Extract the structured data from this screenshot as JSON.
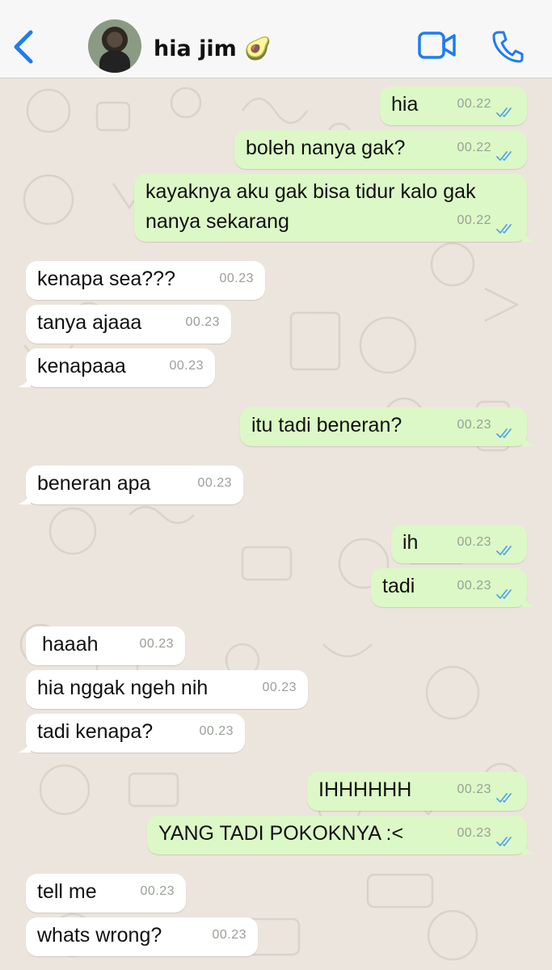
{
  "header": {
    "contact_name": "hia jim 🥑",
    "icons": [
      "chevron-left-icon",
      "video-camera-icon",
      "phone-icon"
    ],
    "accent_color": "#1f7cf0"
  },
  "colors": {
    "outgoing": "#dcf8c6",
    "incoming": "#ffffff",
    "read_ticks": "#53a6e8",
    "wallpaper": "#ece5dd"
  },
  "messages": [
    {
      "dir": "out",
      "text": "hia",
      "time": "00.22"
    },
    {
      "dir": "out",
      "text": "boleh nanya gak?",
      "time": "00.22"
    },
    {
      "dir": "out",
      "text": "kayaknya aku gak bisa tidur kalo gak\nnanya sekarang",
      "time": "00.22"
    },
    {
      "dir": "in",
      "text": "kenapa sea???",
      "time": "00.23"
    },
    {
      "dir": "in",
      "text": "tanya ajaaa",
      "time": "00.23"
    },
    {
      "dir": "in",
      "text": "kenapaaa",
      "time": "00.23"
    },
    {
      "dir": "out",
      "text": "itu tadi beneran?",
      "time": "00.23"
    },
    {
      "dir": "in",
      "text": "beneran apa",
      "time": "00.23"
    },
    {
      "dir": "out",
      "text": "ih",
      "time": "00.23"
    },
    {
      "dir": "out",
      "text": "tadi",
      "time": "00.23"
    },
    {
      "dir": "in",
      "text": "haaah",
      "time": "00.23"
    },
    {
      "dir": "in",
      "text": "hia nggak ngeh nih",
      "time": "00.23"
    },
    {
      "dir": "in",
      "text": "tadi kenapa?",
      "time": "00.23"
    },
    {
      "dir": "out",
      "text": "IHHHHHH",
      "time": "00.23"
    },
    {
      "dir": "out",
      "text": "YANG TADI POKOKNYA :<",
      "time": "00.23"
    },
    {
      "dir": "in",
      "text": "tell me",
      "time": "00.23"
    },
    {
      "dir": "in",
      "text": "whats wrong?",
      "time": "00.23"
    }
  ]
}
